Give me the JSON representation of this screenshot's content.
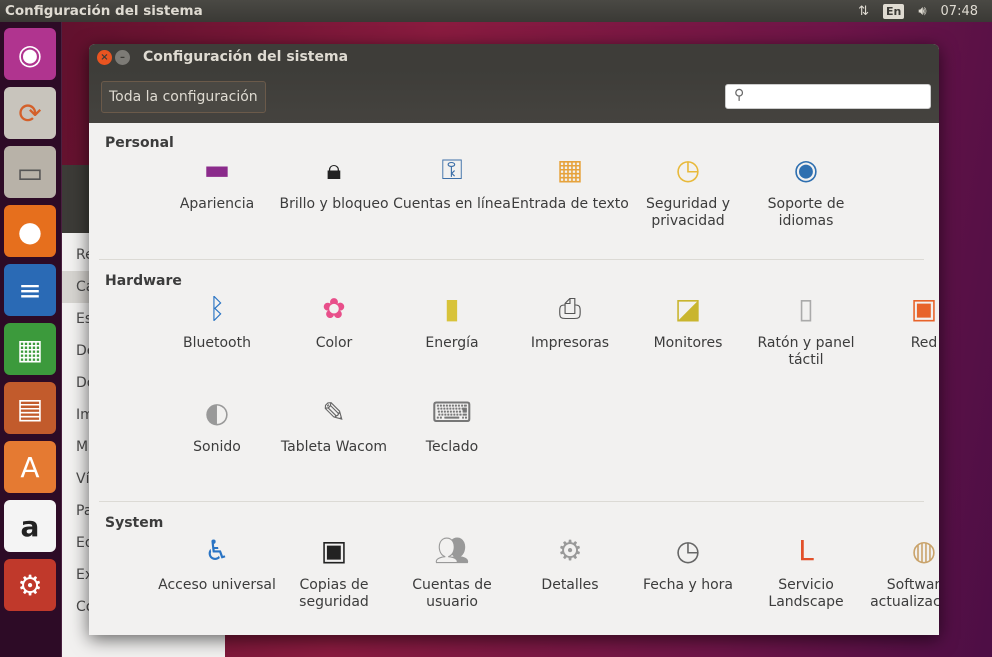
{
  "panel": {
    "title": "Configuración del sistema",
    "keyboard": "En",
    "time": "07:48"
  },
  "launcher": [
    "ubuntu-dash",
    "disk-installer",
    "file-manager",
    "firefox",
    "writer",
    "calc",
    "impress",
    "software-center",
    "amazon",
    "system-settings"
  ],
  "background_window": {
    "items": [
      "Re",
      "Ca",
      "Es",
      "De",
      "Do",
      "Im",
      "Mú",
      "Ví",
      "Pa",
      "Ed",
      "Ex",
      "Co"
    ]
  },
  "window": {
    "title": "Configuración del sistema",
    "all_settings": "Toda la configuración",
    "search_placeholder": ""
  },
  "sections": [
    {
      "title": "Personal",
      "items": [
        {
          "label": "Apariencia",
          "icon": "monitor-purple"
        },
        {
          "label": "Brillo y bloqueo",
          "icon": "lock-monitor"
        },
        {
          "label": "Cuentas en línea",
          "icon": "keys-globe"
        },
        {
          "label": "Entrada de texto",
          "icon": "keyboard-layouts"
        },
        {
          "label": "Seguridad y privacidad",
          "icon": "history-clock"
        },
        {
          "label": "Soporte de idiomas",
          "icon": "flag-globe"
        }
      ]
    },
    {
      "title": "Hardware",
      "items": [
        {
          "label": "Bluetooth",
          "icon": "bluetooth"
        },
        {
          "label": "Color",
          "icon": "color-flower"
        },
        {
          "label": "Energía",
          "icon": "battery"
        },
        {
          "label": "Impresoras",
          "icon": "printer"
        },
        {
          "label": "Monitores",
          "icon": "monitor"
        },
        {
          "label": "Ratón y panel táctil",
          "icon": "mouse"
        },
        {
          "label": "Red",
          "icon": "network-folder"
        },
        {
          "label": "Sonido",
          "icon": "speaker-knob"
        },
        {
          "label": "Tableta Wacom",
          "icon": "tablet-pen"
        },
        {
          "label": "Teclado",
          "icon": "keyboard"
        }
      ]
    },
    {
      "title": "System",
      "items": [
        {
          "label": "Acceso universal",
          "icon": "accessibility"
        },
        {
          "label": "Copias de seguridad",
          "icon": "safe"
        },
        {
          "label": "Cuentas de usuario",
          "icon": "users"
        },
        {
          "label": "Detalles",
          "icon": "gear"
        },
        {
          "label": "Fecha y hora",
          "icon": "clock"
        },
        {
          "label": "Servicio Landscape",
          "icon": "landscape"
        },
        {
          "label": "Software y actualizaciones",
          "icon": "package-globe"
        }
      ]
    }
  ]
}
